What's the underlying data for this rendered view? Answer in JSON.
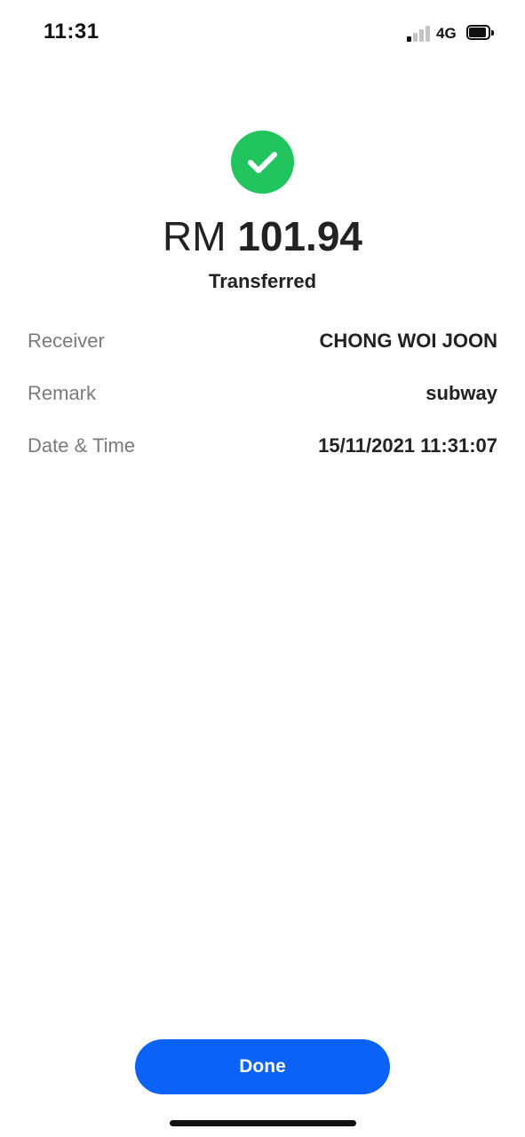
{
  "status_bar": {
    "time": "11:31",
    "network": "4G",
    "signal_bars_active": 1,
    "signal_bars_total": 4,
    "battery_level": 0.9,
    "icons": [
      "cellular-signal-icon",
      "battery-icon"
    ]
  },
  "success": {
    "icon": "check-circle-icon",
    "icon_color": "#21c45d"
  },
  "amount": {
    "currency": "RM",
    "value": "101.94"
  },
  "status_label": "Transferred",
  "details": [
    {
      "label": "Receiver",
      "value": "CHONG WOI JOON"
    },
    {
      "label": "Remark",
      "value": "subway"
    },
    {
      "label": "Date & Time",
      "value": "15/11/2021 11:31:07"
    }
  ],
  "done_button": {
    "label": "Done",
    "color": "#0a63f6"
  }
}
